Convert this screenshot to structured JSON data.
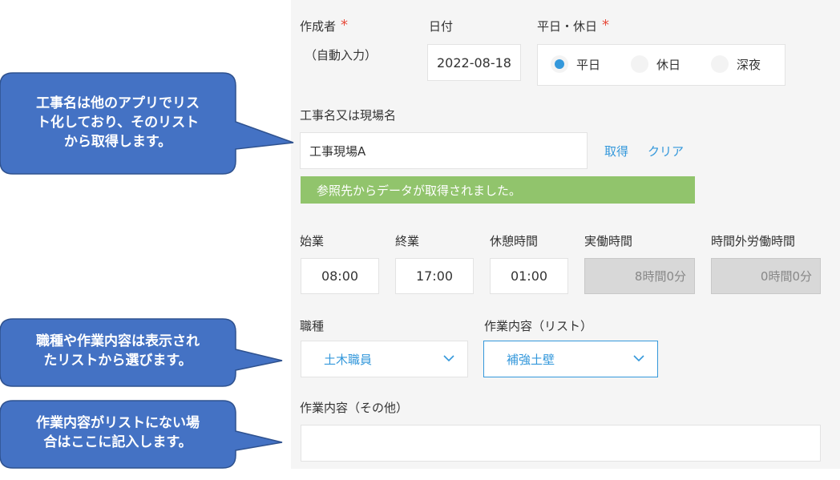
{
  "form": {
    "author": {
      "label": "作成者",
      "required_mark": "*",
      "value": "（自動入力）"
    },
    "date": {
      "label": "日付",
      "value": "2022-08-18"
    },
    "day_type": {
      "label": "平日・休日",
      "required_mark": "*",
      "options": [
        {
          "label": "平日",
          "checked": true
        },
        {
          "label": "休日",
          "checked": false
        },
        {
          "label": "深夜",
          "checked": false
        }
      ]
    },
    "site": {
      "label": "工事名又は現場名",
      "value": "工事現場A",
      "fetch_label": "取得",
      "clear_label": "クリア",
      "notice": "参照先からデータが取得されました。"
    },
    "time": {
      "start": {
        "label": "始業",
        "value": "08:00"
      },
      "end": {
        "label": "終業",
        "value": "17:00"
      },
      "break": {
        "label": "休憩時間",
        "value": "01:00"
      },
      "actual": {
        "label": "実働時間",
        "value": "8時間0分"
      },
      "overtime": {
        "label": "時間外労働時間",
        "value": "0時間0分"
      }
    },
    "job_type": {
      "label": "職種",
      "value": "土木職員"
    },
    "work_list": {
      "label": "作業内容（リスト）",
      "value": "補強土壁"
    },
    "work_other": {
      "label": "作業内容（その他）",
      "value": ""
    }
  },
  "callouts": [
    {
      "lines": [
        "工事名は他のアプリでリス",
        "ト化しており、そのリスト",
        "から取得します。"
      ]
    },
    {
      "lines": [
        "職種や作業内容は表示され",
        "たリストから選びます。"
      ]
    },
    {
      "lines": [
        "作業内容がリストにない場",
        "合はここに記入します。"
      ]
    }
  ],
  "colors": {
    "accent": "#3498db",
    "required": "#e74c3c",
    "notice_bg": "#91c46c",
    "callout_fill": "#4472c4",
    "callout_border": "#2f528f"
  }
}
